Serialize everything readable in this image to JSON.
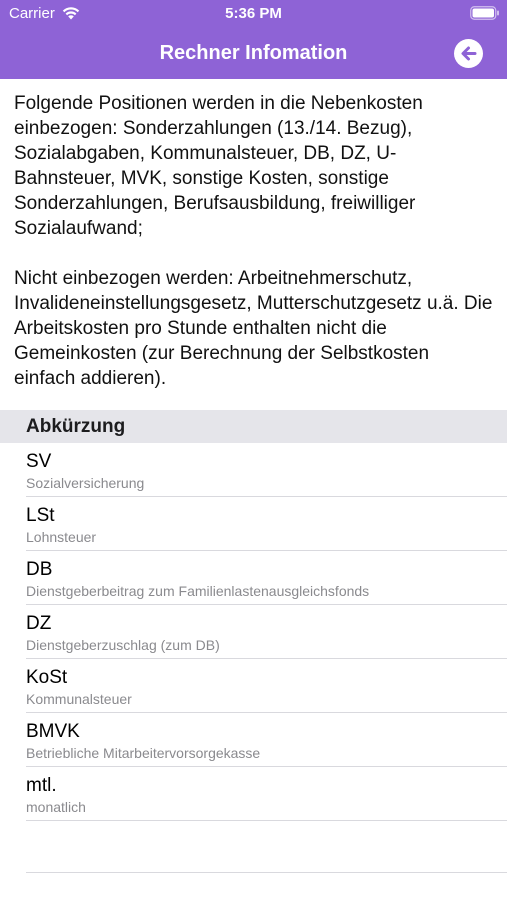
{
  "status_bar": {
    "carrier": "Carrier",
    "time": "5:36 PM"
  },
  "nav": {
    "title": "Rechner Infomation",
    "back_icon": "arrow-left-circle-icon",
    "bar_color": "#8e63d6"
  },
  "info": {
    "paragraph1": "Folgende Positionen werden in die Nebenkosten einbezogen: Sonderzahlungen (13./14. Bezug), Sozialabgaben, Kommunalsteuer, DB, DZ, U-Bahnsteuer, MVK, sonstige Kosten, sonstige Sonderzahlungen, Berufsausbildung, freiwilliger Sozialaufwand;",
    "paragraph2": "Nicht einbezogen werden: Arbeitnehmerschutz, Invalideneinstellungsgesetz, Mutterschutzgesetz u.ä. Die Arbeitskosten pro Stunde enthalten nicht die Gemeinkosten (zur Berechnung der Selbstkosten einfach addieren)."
  },
  "section": {
    "title": "Abkürzung"
  },
  "abbreviations": [
    {
      "abbr": "SV",
      "desc": "Sozialversicherung"
    },
    {
      "abbr": "LSt",
      "desc": "Lohnsteuer"
    },
    {
      "abbr": "DB",
      "desc": "Dienstgeberbeitrag zum Familienlastenausgleichsfonds"
    },
    {
      "abbr": "DZ",
      "desc": "Dienstgeberzuschlag (zum DB)"
    },
    {
      "abbr": "KoSt",
      "desc": "Kommunalsteuer"
    },
    {
      "abbr": "BMVK",
      "desc": "Betriebliche Mitarbeitervorsorgekasse"
    },
    {
      "abbr": "mtl.",
      "desc": "monatlich"
    }
  ]
}
